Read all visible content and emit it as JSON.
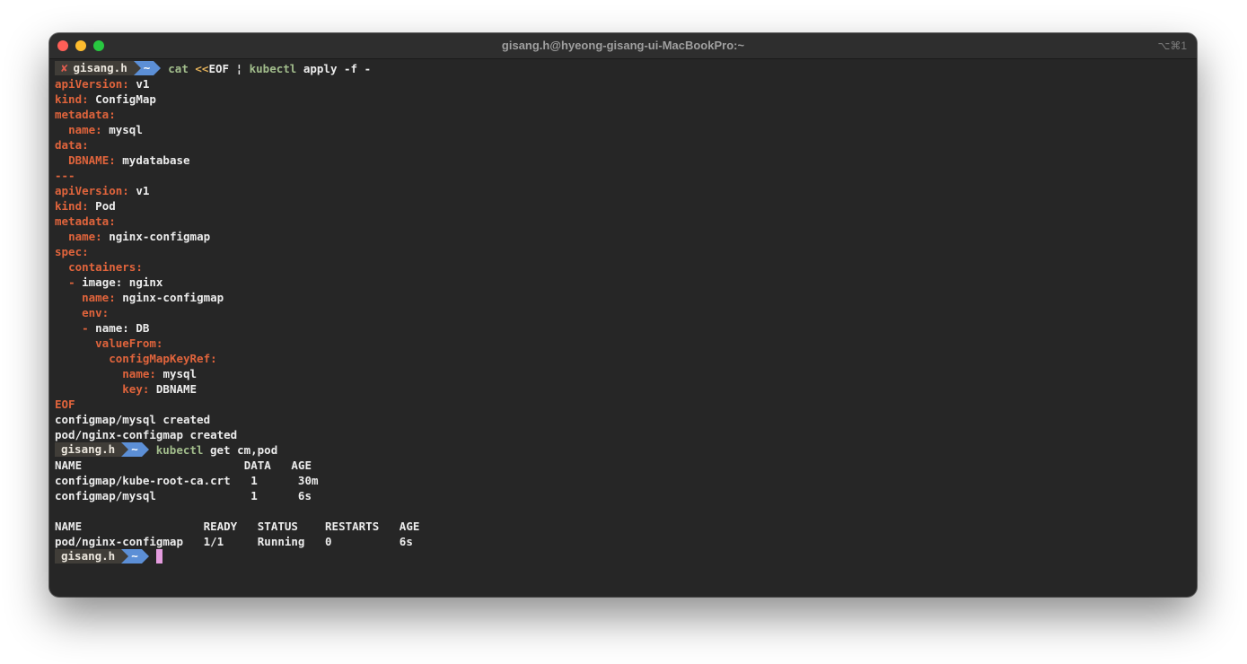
{
  "window": {
    "title": "gisang.h@hyeong-gisang-ui-MacBookPro:~",
    "shortcut": "⌥⌘1"
  },
  "prompt": {
    "error_mark": "✘",
    "user": "gisang.h",
    "dir": "~"
  },
  "command1": {
    "cmd1": "cat",
    "redirect": "<<",
    "rest1": "EOF",
    "pipe": "¦",
    "cmd2": "kubectl",
    "rest2": "apply -f -"
  },
  "yaml": [
    {
      "indent": "",
      "key": "apiVersion:",
      "value": "v1"
    },
    {
      "indent": "",
      "key": "kind:",
      "value": "ConfigMap"
    },
    {
      "indent": "",
      "key": "metadata:",
      "value": ""
    },
    {
      "indent": "  ",
      "key": "name:",
      "value": "mysql"
    },
    {
      "indent": "",
      "key": "data:",
      "value": ""
    },
    {
      "indent": "  ",
      "key": "DBNAME:",
      "value": "mydatabase"
    },
    {
      "indent": "",
      "key": "---",
      "value": ""
    },
    {
      "indent": "",
      "key": "apiVersion:",
      "value": "v1"
    },
    {
      "indent": "",
      "key": "kind:",
      "value": "Pod"
    },
    {
      "indent": "",
      "key": "metadata:",
      "value": ""
    },
    {
      "indent": "  ",
      "key": "name:",
      "value": "nginx-configmap"
    },
    {
      "indent": "",
      "key": "spec:",
      "value": ""
    },
    {
      "indent": "  ",
      "key": "containers:",
      "value": ""
    },
    {
      "indent": "  ",
      "key": "-",
      "value": "image: nginx"
    },
    {
      "indent": "    ",
      "key": "name:",
      "value": "nginx-configmap"
    },
    {
      "indent": "    ",
      "key": "env:",
      "value": ""
    },
    {
      "indent": "    ",
      "key": "-",
      "value": "name: DB"
    },
    {
      "indent": "      ",
      "key": "valueFrom:",
      "value": ""
    },
    {
      "indent": "        ",
      "key": "configMapKeyRef:",
      "value": ""
    },
    {
      "indent": "          ",
      "key": "name:",
      "value": "mysql"
    },
    {
      "indent": "          ",
      "key": "key:",
      "value": "DBNAME"
    },
    {
      "indent": "",
      "key": "EOF",
      "value": ""
    }
  ],
  "apply_output": [
    "configmap/mysql created",
    "pod/nginx-configmap created"
  ],
  "command2": {
    "cmd": "kubectl",
    "args": "get cm,pod"
  },
  "get_output": [
    "NAME                        DATA   AGE",
    "configmap/kube-root-ca.crt   1      30m",
    "configmap/mysql              1      6s",
    "",
    "NAME                  READY   STATUS    RESTARTS   AGE",
    "pod/nginx-configmap   1/1     Running   0          6s"
  ]
}
